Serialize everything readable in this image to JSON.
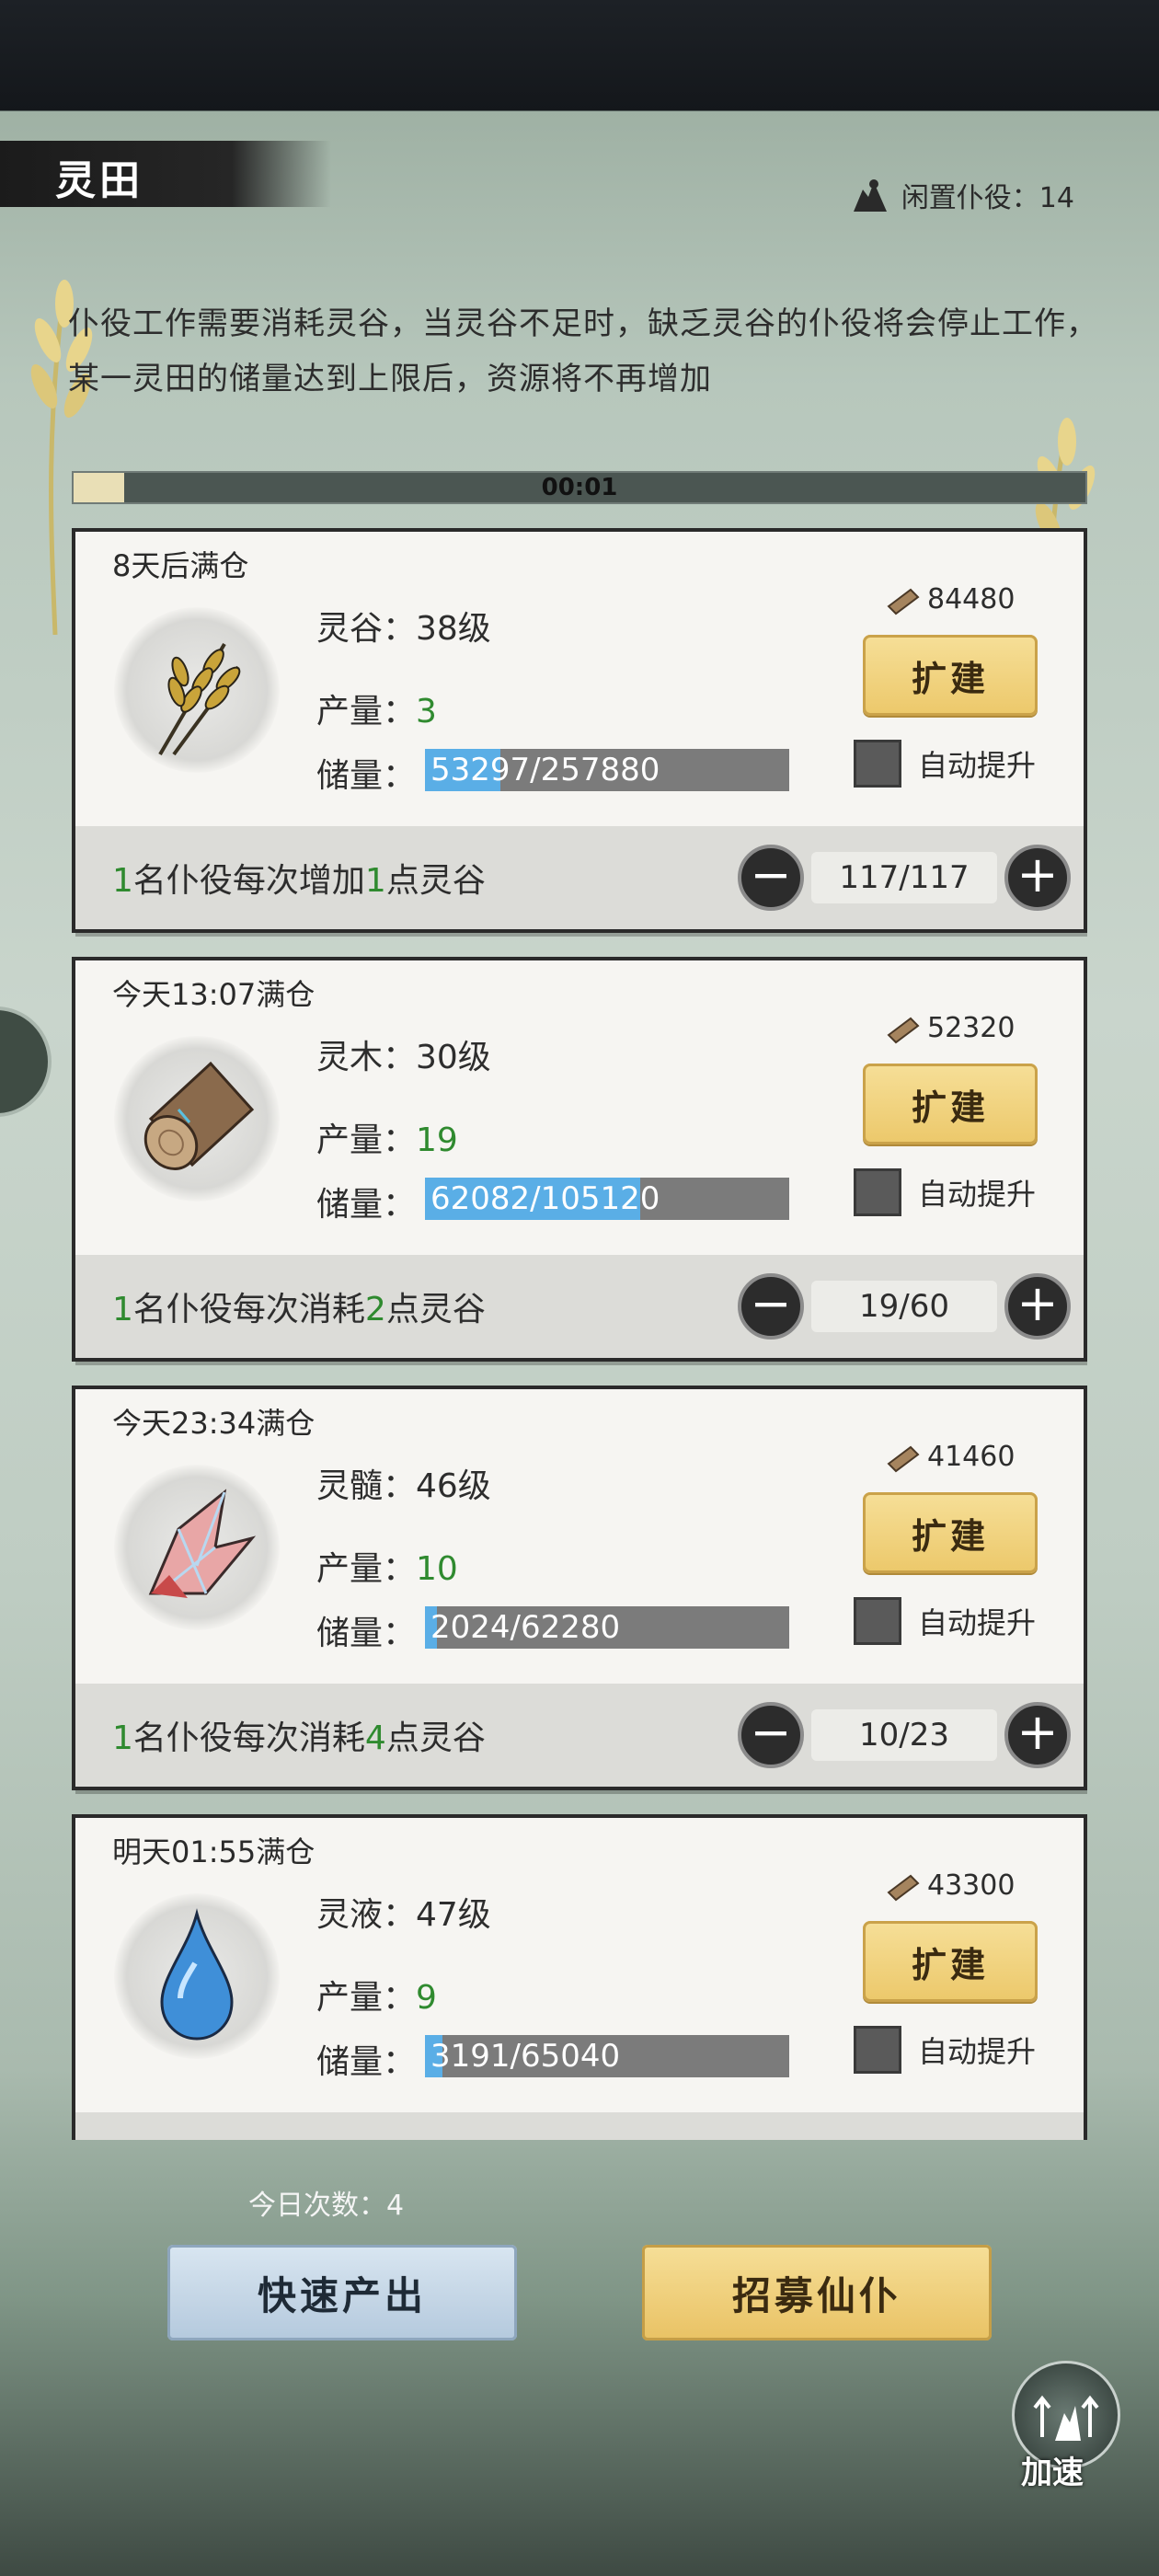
{
  "header": {
    "title": "灵田",
    "idle_servants_label": "闲置仆役：14"
  },
  "intro_text": "仆役工作需要消耗灵谷，当灵谷不足时，缺乏灵谷的仆役将会停止工作，某一灵田的储量达到上限后，资源将不再增加",
  "timer": {
    "text": "00:01",
    "progress": 0.05
  },
  "fields": [
    {
      "full_time": "8天后满仓",
      "icon": "grain-icon",
      "level_text": "灵谷：38级",
      "output_label": "产量：",
      "output_value": "3",
      "storage_label": "储量：",
      "storage_text": "53297/257880",
      "storage_fraction": 0.207,
      "cost": "84480",
      "expand_label": "扩建",
      "auto_label": "自动提升",
      "rule_a": "1",
      "rule_mid": "名仆役每次增加",
      "rule_b": "1",
      "rule_end": "点灵谷",
      "workers": "117/117"
    },
    {
      "full_time": "今天13:07满仓",
      "icon": "wood-icon",
      "level_text": "灵木：30级",
      "output_label": "产量：",
      "output_value": "19",
      "storage_label": "储量：",
      "storage_text": "62082/105120",
      "storage_fraction": 0.59,
      "cost": "52320",
      "expand_label": "扩建",
      "auto_label": "自动提升",
      "rule_a": "1",
      "rule_mid": "名仆役每次消耗",
      "rule_b": "2",
      "rule_end": "点灵谷",
      "workers": "19/60"
    },
    {
      "full_time": "今天23:34满仓",
      "icon": "crystal-icon",
      "level_text": "灵髓：46级",
      "output_label": "产量：",
      "output_value": "10",
      "storage_label": "储量：",
      "storage_text": "2024/62280",
      "storage_fraction": 0.033,
      "cost": "41460",
      "expand_label": "扩建",
      "auto_label": "自动提升",
      "rule_a": "1",
      "rule_mid": "名仆役每次消耗",
      "rule_b": "4",
      "rule_end": "点灵谷",
      "workers": "10/23"
    },
    {
      "full_time": "明天01:55满仓",
      "icon": "water-drop-icon",
      "level_text": "灵液：47级",
      "output_label": "产量：",
      "output_value": "9",
      "storage_label": "储量：",
      "storage_text": "3191/65040",
      "storage_fraction": 0.049,
      "cost": "43300",
      "expand_label": "扩建",
      "auto_label": "自动提升"
    }
  ],
  "footer": {
    "today_count": "今日次数：4",
    "quick_output_label": "快速产出",
    "recruit_label": "招募仙仆",
    "speed_label": "加速"
  }
}
